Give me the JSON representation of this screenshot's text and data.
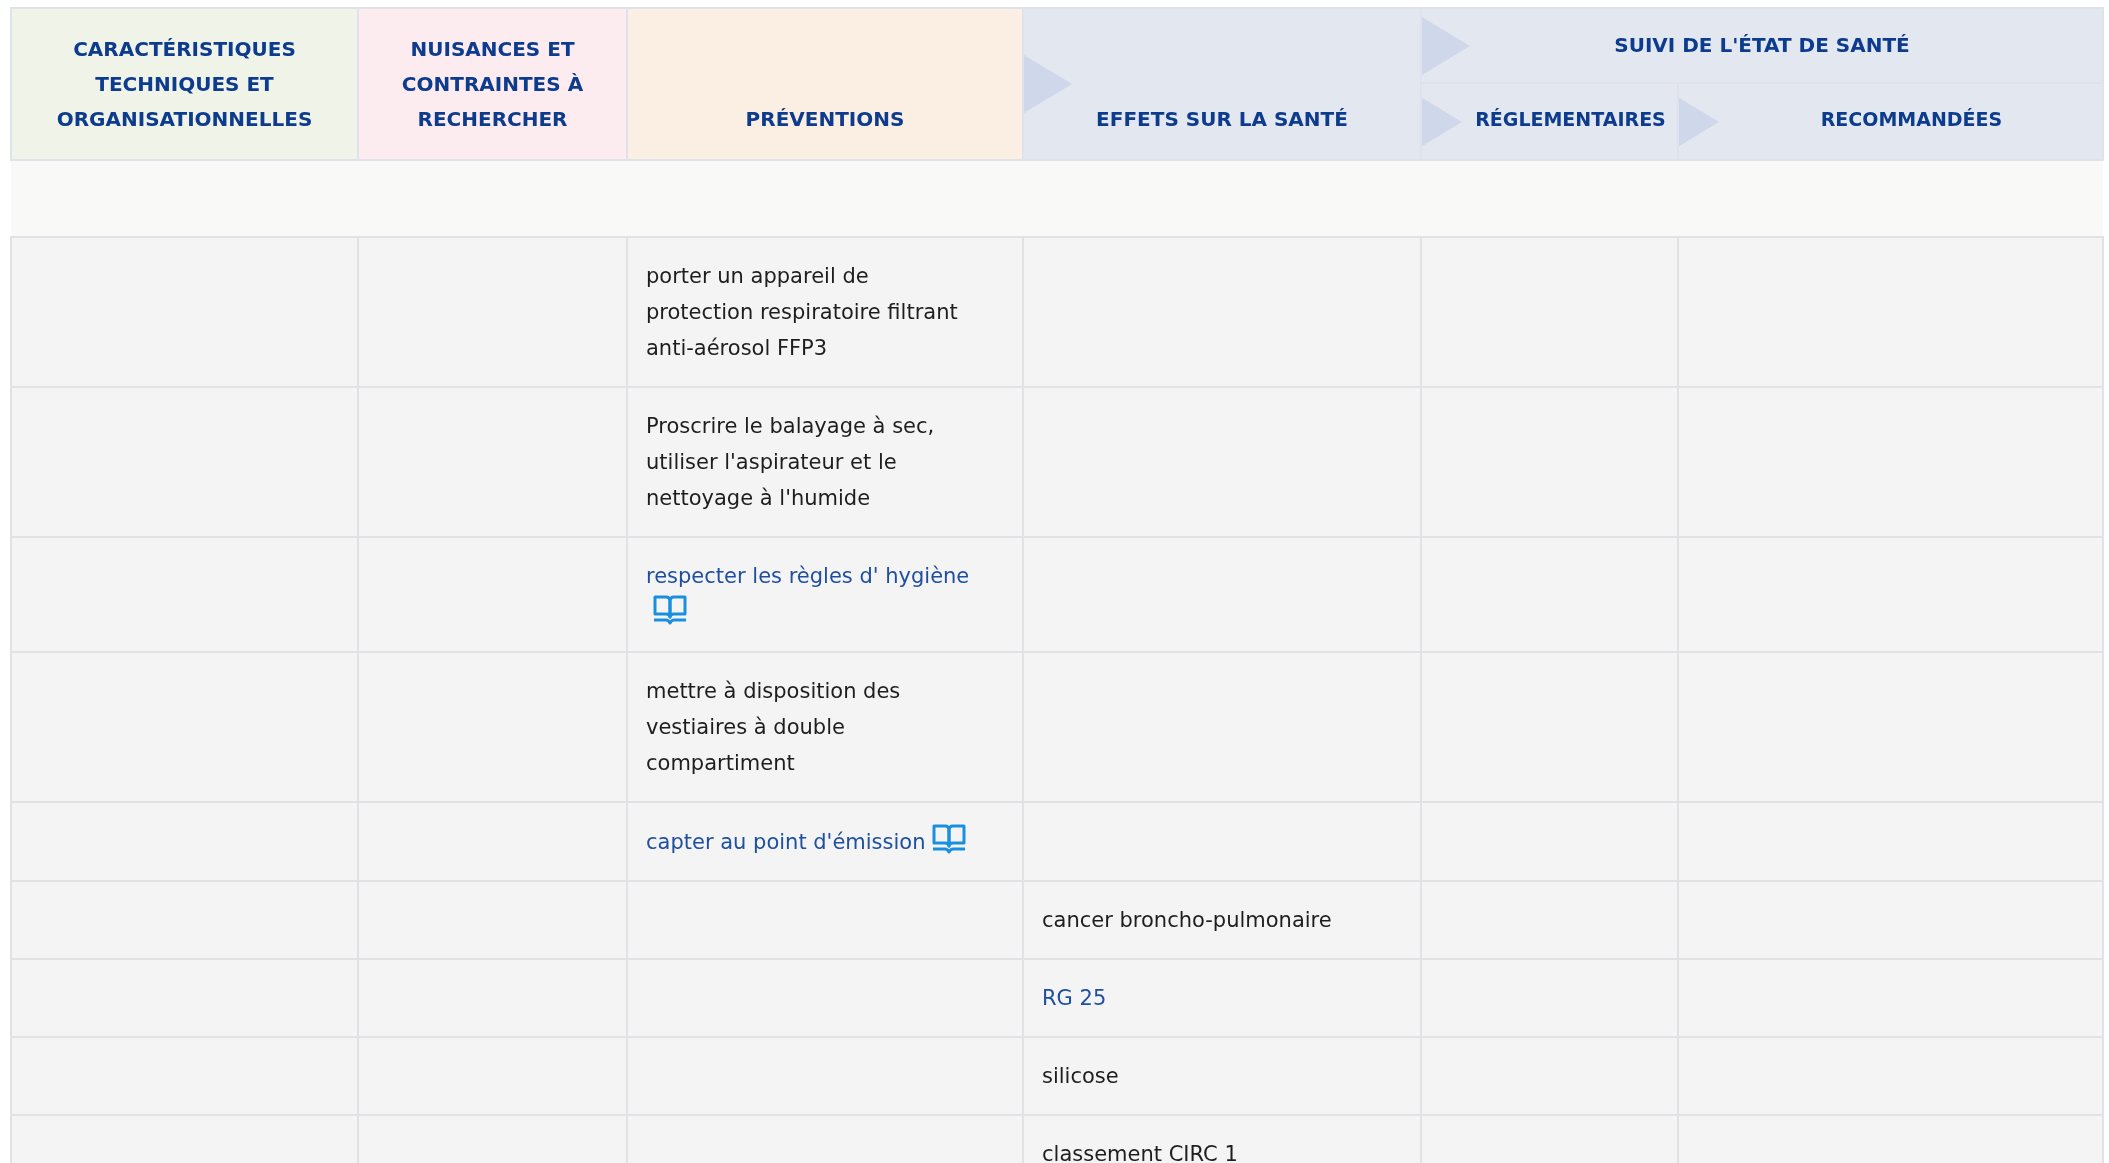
{
  "header": {
    "columns": [
      {
        "label": "CARACTÉRISTIQUES TECHNIQUES ET ORGANISATIONNELLES",
        "color": "#f0f3e7",
        "arrow": false
      },
      {
        "label": "NUISANCES ET CONTRAINTES À RECHERCHER",
        "color": "#fcecf0",
        "arrow": false
      },
      {
        "label": "PRÉVENTIONS",
        "color": "#fbefe3",
        "arrow": false
      },
      {
        "label": "EFFETS SUR LA SANTÉ",
        "color": "#e3e8f0",
        "arrow": true
      }
    ],
    "group": {
      "label": "SUIVI DE L'ÉTAT DE SANTÉ",
      "color": "#e3e8f0",
      "arrow": true,
      "columns": [
        {
          "label": "RÉGLEMENTAIRES",
          "arrow": true
        },
        {
          "label": "RECOMMANDÉES",
          "arrow": true
        }
      ]
    }
  },
  "rows": [
    {
      "preventions": {
        "kind": "text",
        "text": "porter un appareil de protection respiratoire filtrant anti-aérosol FFP3",
        "with_reference": false
      }
    },
    {
      "preventions": {
        "kind": "text",
        "text": "Proscrire le balayage à sec, utiliser l'aspirateur et le nettoyage à l'humide",
        "with_reference": false
      }
    },
    {
      "preventions": {
        "kind": "link",
        "text": "respecter les règles d' hygiène",
        "with_reference": true
      }
    },
    {
      "preventions": {
        "kind": "text",
        "text": "mettre à disposition des vestiaires à double compartiment",
        "with_reference": false
      }
    },
    {
      "preventions": {
        "kind": "link",
        "text": "capter au point d'émission",
        "with_reference": true
      }
    },
    {
      "effets_sur_la_sante": {
        "kind": "text",
        "text": "cancer broncho-pulmonaire",
        "with_reference": false
      }
    },
    {
      "effets_sur_la_sante": {
        "kind": "link",
        "text": "RG 25",
        "with_reference": false
      }
    },
    {
      "effets_sur_la_sante": {
        "kind": "text",
        "text": "silicose",
        "with_reference": false
      }
    },
    {
      "effets_sur_la_sante": {
        "kind": "text",
        "text": "classement CIRC 1",
        "with_reference": false
      }
    }
  ]
}
